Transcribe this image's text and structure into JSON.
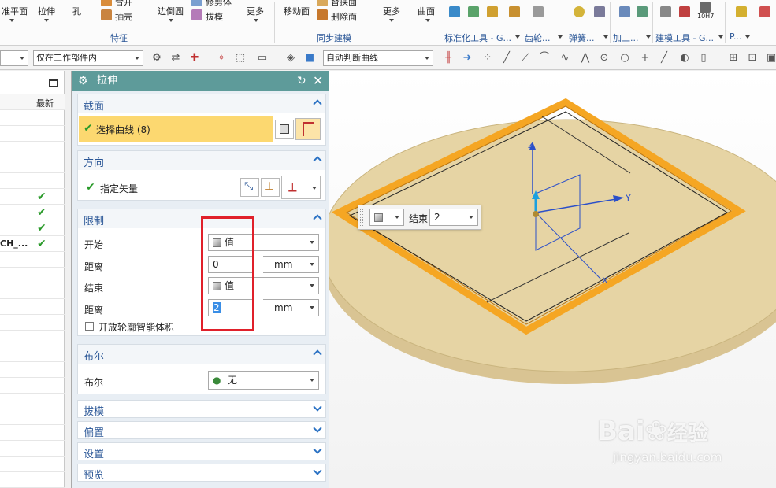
{
  "ribbon": {
    "buttons": {
      "datum_plane": "准平面",
      "extrude": "拉伸",
      "hole": "孔",
      "unite": "合并",
      "shell": "抽壳",
      "edge_blend": "边倒圆",
      "trim_body": "修剪体",
      "draft": "拔模",
      "more1": "更多",
      "move_face": "移动面",
      "replace_face": "替换面",
      "delete_face": "删除面",
      "more2": "更多",
      "surface": "曲面"
    },
    "groups": {
      "feature": "特征",
      "sync_model": "同步建模",
      "standard_tools": "标准化工具 - G...",
      "gear": "齿轮...",
      "spring": "弹簧...",
      "machining": "加工...",
      "modeling_tools": "建模工具 - G...",
      "p": "P...",
      "tol_label": "10H7"
    }
  },
  "toolbar2": {
    "filter_combo": "",
    "scope_combo": "仅在工作部件内",
    "curve_rule": "自动判断曲线"
  },
  "leftnav": {
    "header_col": "最新",
    "row_label": "CH_...",
    "check_rows": [
      0,
      1,
      2,
      3
    ]
  },
  "dialog": {
    "title": "拉伸",
    "section": {
      "header": "截面",
      "select_curve": "选择曲线 (8)"
    },
    "direction": {
      "header": "方向",
      "specify_vector": "指定矢量"
    },
    "limits": {
      "header": "限制",
      "start_label": "开始",
      "start_value": "值",
      "distance1_label": "距离",
      "distance1_value": "0",
      "distance1_unit": "mm",
      "end_label": "结束",
      "end_value": "值",
      "distance2_label": "距离",
      "distance2_value": "2",
      "distance2_unit": "mm",
      "open_profile": "开放轮廓智能体积"
    },
    "boolean": {
      "header": "布尔",
      "label": "布尔",
      "value": "无"
    },
    "collapsed": [
      "拔模",
      "偏置",
      "设置",
      "预览"
    ]
  },
  "viewport": {
    "float_end_label": "结束",
    "float_end_value": "2",
    "axis_x": "X",
    "axis_y": "Y",
    "axis_z": "Z"
  },
  "watermark": {
    "brand": "Bai",
    "brand2": "经验",
    "url": "jingyan.baidu.com"
  },
  "colors": {
    "title_bar": "#5e9b9a",
    "section_text": "#2b5797",
    "selected_row": "#fcd870",
    "check_green": "#2a9a2a",
    "frame_orange": "#f5a623",
    "disk": "#e6d4a4",
    "highlight_red": "#e0202a"
  }
}
